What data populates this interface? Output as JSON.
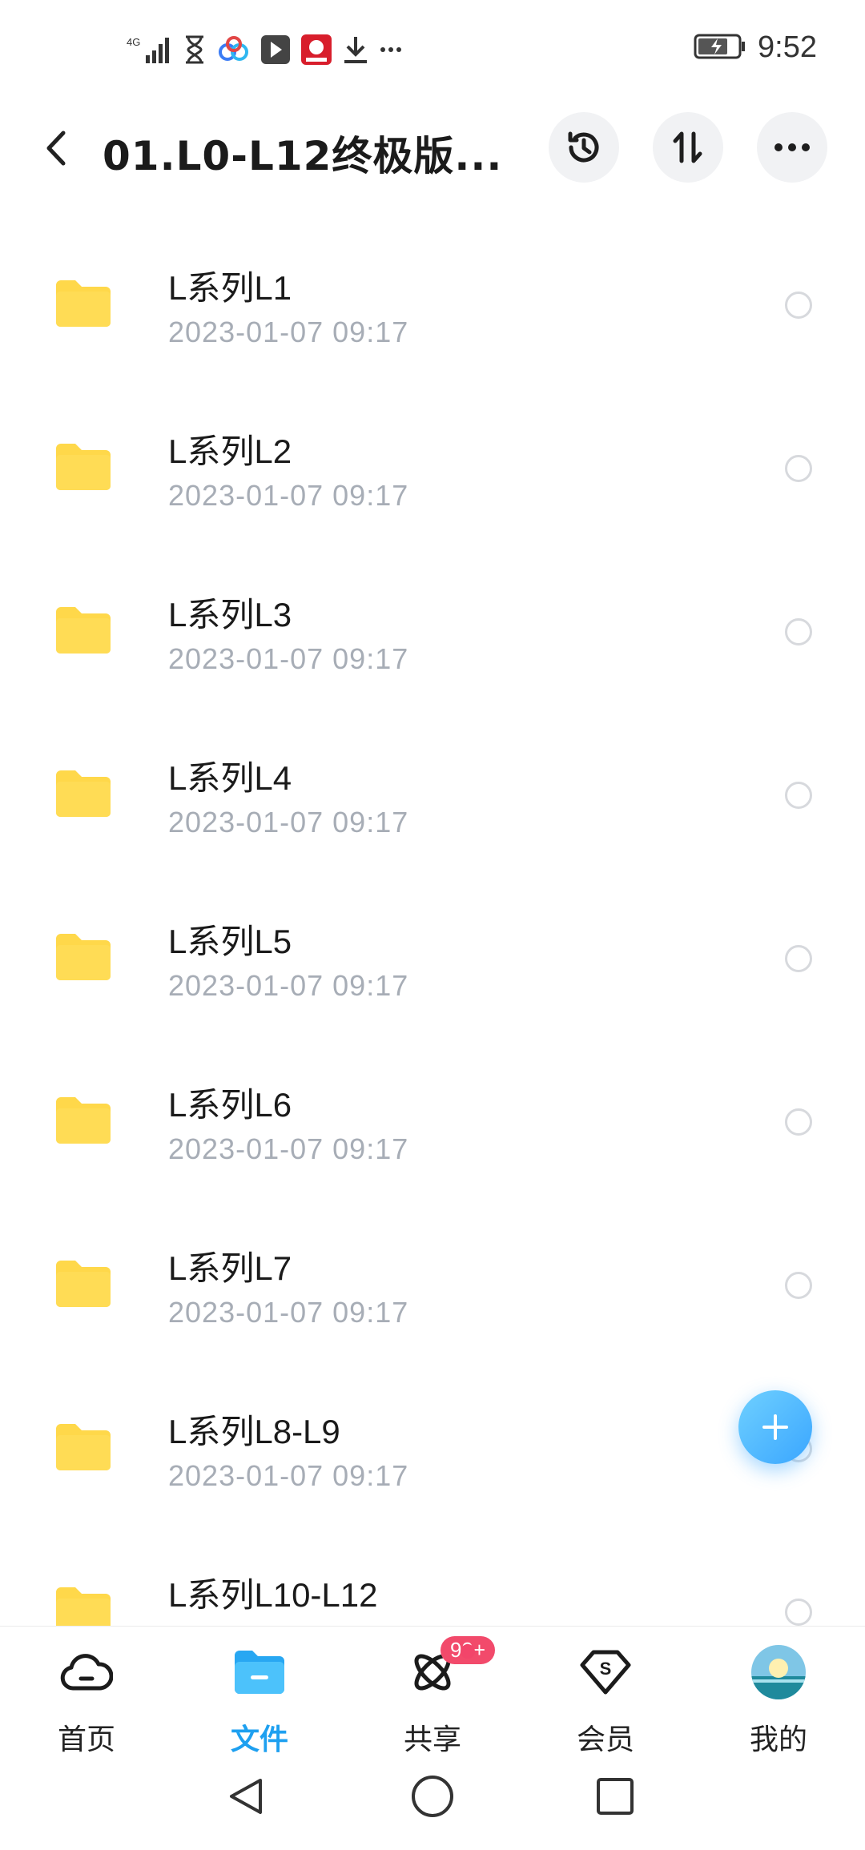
{
  "status_bar": {
    "time": "9:52",
    "network": "4G",
    "icons": [
      "signal-icon",
      "hourglass-icon",
      "cloud-app-icon",
      "app-icon",
      "news-app-icon",
      "download-icon",
      "more-dots-icon"
    ],
    "battery": "charging"
  },
  "header": {
    "title": "01.L0-L12终极版...",
    "history_icon": "history-icon",
    "sort_icon": "sort-icon",
    "more_icon": "more-icon"
  },
  "files": [
    {
      "name": "L系列L1",
      "date": "2023-01-07  09:17"
    },
    {
      "name": "L系列L2",
      "date": "2023-01-07  09:17"
    },
    {
      "name": "L系列L3",
      "date": "2023-01-07  09:17"
    },
    {
      "name": "L系列L4",
      "date": "2023-01-07  09:17"
    },
    {
      "name": "L系列L5",
      "date": "2023-01-07  09:17"
    },
    {
      "name": "L系列L6",
      "date": "2023-01-07  09:17"
    },
    {
      "name": "L系列L7",
      "date": "2023-01-07  09:17"
    },
    {
      "name": "L系列L8-L9",
      "date": "2023-01-07  09:17"
    },
    {
      "name": "L系列L10-L12",
      "date": ""
    }
  ],
  "tabs": [
    {
      "label": "首页",
      "icon": "cloud-home-icon"
    },
    {
      "label": "文件",
      "icon": "folder-icon",
      "active": true
    },
    {
      "label": "共享",
      "icon": "share-orbit-icon",
      "badge": "99+"
    },
    {
      "label": "会员",
      "icon": "vip-diamond-icon"
    },
    {
      "label": "我的",
      "icon": "avatar-icon"
    }
  ],
  "colors": {
    "accent": "#1ea0f0",
    "folder": "#ffd84a",
    "badge": "#f24a6b"
  }
}
